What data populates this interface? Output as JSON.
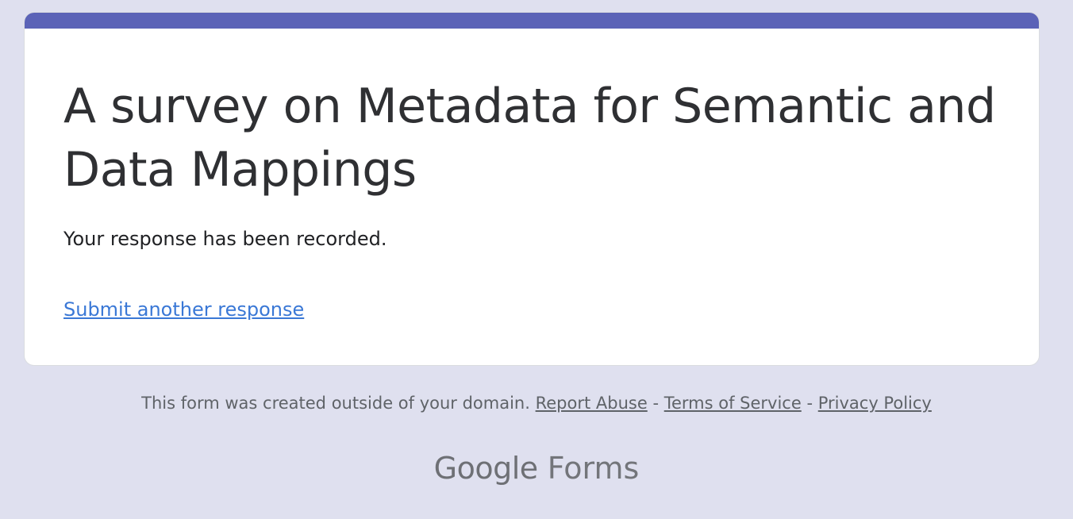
{
  "form": {
    "title": "A survey on Metadata for Semantic and Data Mappings",
    "confirmation": "Your response has been recorded.",
    "submit_another_label": "Submit another response",
    "accent_color": "#5b63b7"
  },
  "footer": {
    "notice": "This form was created outside of your domain.",
    "report_abuse": "Report Abuse",
    "separator": "-",
    "terms": "Terms of Service",
    "privacy": "Privacy Policy"
  },
  "brand": {
    "google": "Google",
    "forms": "Forms"
  },
  "colors": {
    "background": "#dfe0ef",
    "card": "#ffffff",
    "link": "#3a78d6"
  }
}
